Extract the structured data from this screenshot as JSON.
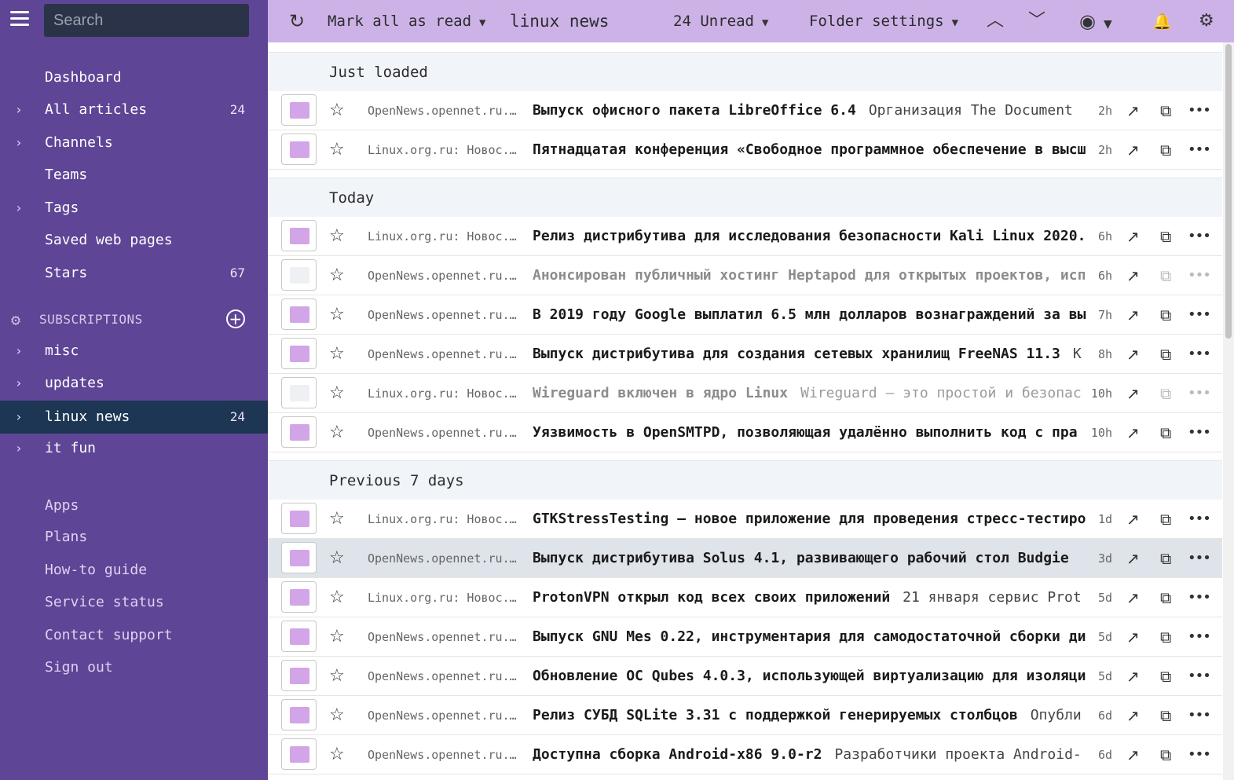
{
  "sidebar": {
    "search_placeholder": "Search",
    "nav": [
      {
        "label": "Dashboard",
        "count": "",
        "chevron": false
      },
      {
        "label": "All articles",
        "count": "24",
        "chevron": true
      },
      {
        "label": "Channels",
        "count": "",
        "chevron": true
      },
      {
        "label": "Teams",
        "count": "",
        "chevron": false
      },
      {
        "label": "Tags",
        "count": "",
        "chevron": true
      },
      {
        "label": "Saved web pages",
        "count": "",
        "chevron": false
      },
      {
        "label": "Stars",
        "count": "67",
        "chevron": false
      }
    ],
    "subscriptions_label": "SUBSCRIPTIONS",
    "folders": [
      {
        "label": "misc",
        "count": ""
      },
      {
        "label": "updates",
        "count": ""
      },
      {
        "label": "linux news",
        "count": "24",
        "active": true
      },
      {
        "label": "it fun",
        "count": ""
      }
    ],
    "footer": [
      "Apps",
      "Plans",
      "How-to guide",
      "Service status",
      "Contact support",
      "Sign out"
    ]
  },
  "toolbar": {
    "mark_all_read": "Mark all as read",
    "folder_title": "linux news",
    "unread": "24 Unread",
    "folder_settings": "Folder settings"
  },
  "icons": {
    "refresh": "refresh-icon",
    "dropdown": "chevron-down-icon",
    "up": "chevron-up-icon",
    "eye": "eye-icon",
    "bell": "bell-icon",
    "gear": "gear-icon",
    "star": "star-icon",
    "trend": "trending-icon",
    "external": "external-link-icon",
    "more": "more-icon"
  },
  "colors": {
    "sidebar": "#5e4596",
    "toolbar": "#cdb2e8",
    "active": "#1d3654",
    "unread_marker": "#d2a4e8"
  },
  "groups": [
    {
      "label": "Just loaded",
      "rows": [
        {
          "source": "OpenNews.opennet.ru...",
          "title": "Выпуск офисного пакета LibreOffice 6.4",
          "snippet": "Организация The Document",
          "time": "2h",
          "read": false
        },
        {
          "source": "Linux.org.ru: Новос...",
          "title": "Пятнадцатая конференция «Свободное программное обеспечение в высш",
          "snippet": "",
          "time": "2h",
          "read": false
        }
      ]
    },
    {
      "label": "Today",
      "rows": [
        {
          "source": "Linux.org.ru: Новос...",
          "title": "Релиз дистрибутива для исследования безопасности Kali Linux 2020.",
          "snippet": "",
          "time": "6h",
          "read": false
        },
        {
          "source": "OpenNews.opennet.ru...",
          "title": "Анонсирован публичный хостинг Heptapod для открытых проектов, исп",
          "snippet": "",
          "time": "6h",
          "read": true
        },
        {
          "source": "OpenNews.opennet.ru...",
          "title": "В 2019 году Google выплатил 6.5 млн долларов вознаграждений за вы",
          "snippet": "",
          "time": "7h",
          "read": false
        },
        {
          "source": "OpenNews.opennet.ru...",
          "title": "Выпуск дистрибутива для создания сетевых хранилищ FreeNAS 11.3",
          "snippet": "К",
          "time": "8h",
          "read": false
        },
        {
          "source": "Linux.org.ru: Новос...",
          "title": "Wireguard включен в ядро Linux",
          "snippet": "Wireguard – это простой и безопас",
          "time": "10h",
          "read": true
        },
        {
          "source": "OpenNews.opennet.ru...",
          "title": "Уязвимость в OpenSMTPD, позволяющая удалённо выполнить код с пра",
          "snippet": "",
          "time": "10h",
          "read": false
        }
      ]
    },
    {
      "label": "Previous 7 days",
      "rows": [
        {
          "source": "Linux.org.ru: Новос...",
          "title": "GTKStressTesting – новое приложение для проведения стресс-тестиро",
          "snippet": "",
          "time": "1d",
          "read": false
        },
        {
          "source": "OpenNews.opennet.ru...",
          "title": "Выпуск дистрибутива Solus 4.1, развивающего рабочий стол Budgie",
          "snippet": "",
          "time": "3d",
          "read": false,
          "highlight": true
        },
        {
          "source": "Linux.org.ru: Новос...",
          "title": "ProtonVPN открыл код всех своих приложений",
          "snippet": "21 января сервис Prot",
          "time": "5d",
          "read": false
        },
        {
          "source": "OpenNews.opennet.ru...",
          "title": "Выпуск GNU Mes 0.22, инструментария для самодостаточной сборки ди",
          "snippet": "",
          "time": "5d",
          "read": false
        },
        {
          "source": "OpenNews.opennet.ru...",
          "title": "Обновление ОС Qubes 4.0.3, использующей виртуализацию для изоляци",
          "snippet": "",
          "time": "5d",
          "read": false
        },
        {
          "source": "OpenNews.opennet.ru...",
          "title": "Релиз СУБД SQLite 3.31 с поддержкой генерируемых столбцов",
          "snippet": "Опубли",
          "time": "6d",
          "read": false
        },
        {
          "source": "OpenNews.opennet.ru...",
          "title": "Доступна сборка Android-x86 9.0-r2",
          "snippet": "Разработчики проекта Android-",
          "time": "6d",
          "read": false
        }
      ]
    }
  ]
}
